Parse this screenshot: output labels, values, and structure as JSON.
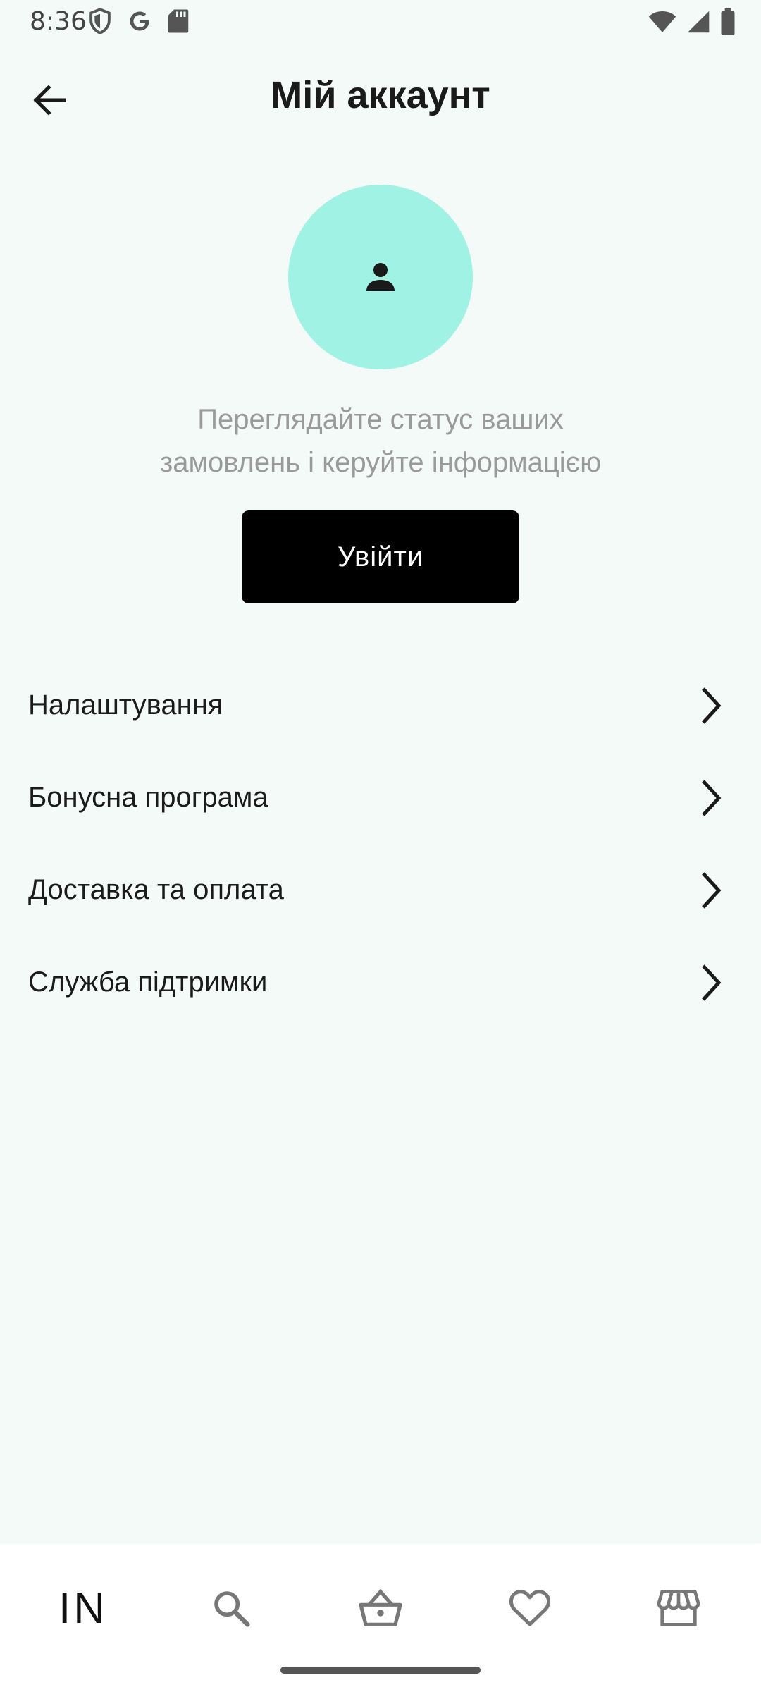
{
  "status_bar": {
    "time": "8:36",
    "left_icons": [
      "shield-icon",
      "google-icon",
      "sd-card-icon"
    ],
    "right_icons": [
      "wifi-icon",
      "signal-icon",
      "battery-icon"
    ]
  },
  "header": {
    "title": "Мій аккаунт",
    "back_icon": "arrow-left-icon"
  },
  "profile": {
    "avatar_icon": "person-icon",
    "avatar_color": "#9ff2e4",
    "info_line1": "Переглядайте статус ваших",
    "info_line2": "замовлень і керуйте інформацією",
    "login_label": "Увійти"
  },
  "menu": {
    "items": [
      {
        "label": "Налаштування"
      },
      {
        "label": "Бонусна програма"
      },
      {
        "label": "Доставка та оплата"
      },
      {
        "label": "Служба підтримки"
      }
    ]
  },
  "bottom_nav": {
    "logo": "IN",
    "items": [
      "home-logo",
      "search-icon",
      "basket-icon",
      "heart-icon",
      "store-icon"
    ]
  }
}
